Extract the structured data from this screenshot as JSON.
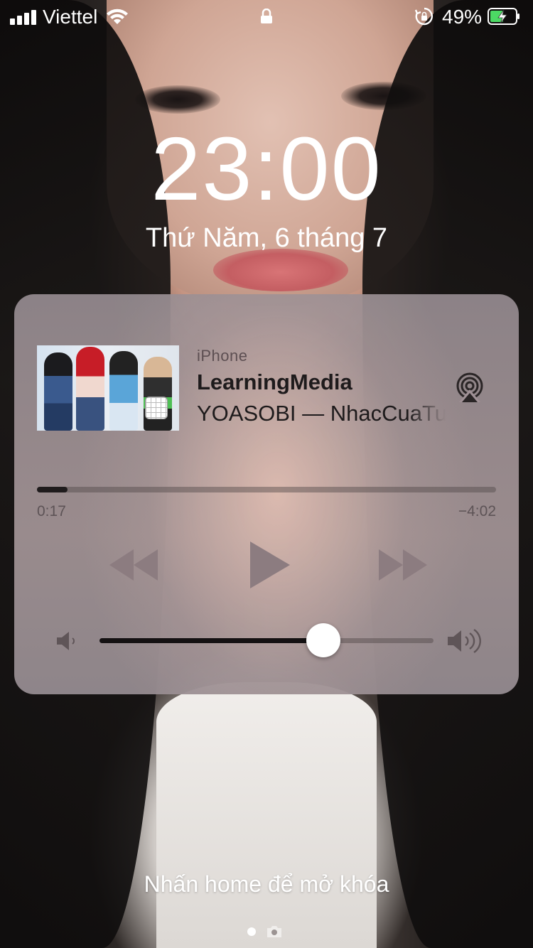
{
  "status_bar": {
    "carrier": "Viettel",
    "battery_percent": "49%",
    "icons": [
      "signal-icon",
      "wifi-icon",
      "lock-icon",
      "orientation-lock-icon",
      "battery-charging-icon"
    ]
  },
  "lock_screen": {
    "time": "23:00",
    "date": "Thứ Năm, 6 tháng 7",
    "unlock_hint": "Nhấn home để mở khóa"
  },
  "now_playing": {
    "source": "iPhone",
    "title": "LearningMedia",
    "subtitle": "YOASOBI — NhacCuaTui",
    "elapsed": "0:17",
    "remaining": "−4:02",
    "progress_fraction": 0.066,
    "volume_fraction": 0.67,
    "icons": [
      "airplay-icon",
      "rewind-icon",
      "play-icon",
      "fast-forward-icon",
      "volume-low-icon",
      "volume-high-icon"
    ]
  },
  "pager": {
    "pages": 1,
    "active_index": 0,
    "icons": [
      "page-dot-icon",
      "camera-icon"
    ]
  }
}
